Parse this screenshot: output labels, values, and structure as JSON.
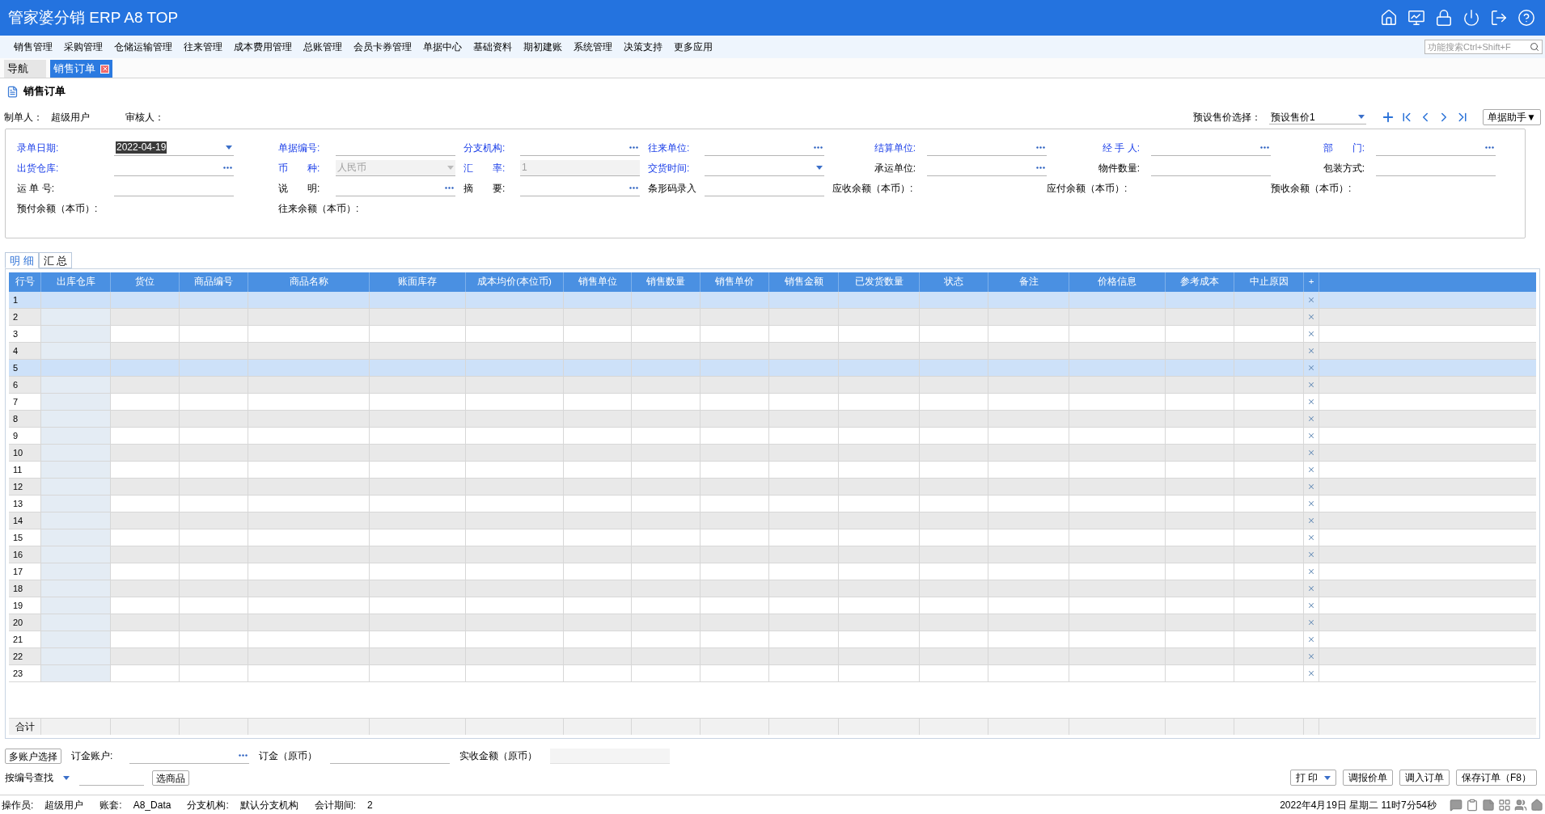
{
  "app_title": "管家婆分销 ERP A8 TOP",
  "menu": [
    "销售管理",
    "采购管理",
    "仓储运输管理",
    "往来管理",
    "成本费用管理",
    "总账管理",
    "会员卡券管理",
    "单据中心",
    "基础资料",
    "期初建账",
    "系统管理",
    "决策支持",
    "更多应用"
  ],
  "search": {
    "placeholder": "功能搜索Ctrl+Shift+F"
  },
  "tabs": [
    {
      "label": "导航",
      "selected": false,
      "closable": false
    },
    {
      "label": "销售订单",
      "selected": true,
      "closable": true
    }
  ],
  "page_title": "销售订单",
  "maker": {
    "label": "制单人：",
    "value": "超级用户",
    "reviewer_label": "审核人："
  },
  "price_select": {
    "label": "预设售价选择：",
    "value": "预设售价1"
  },
  "assistant_button": "单据助手▼",
  "form": [
    [
      {
        "label": "录单日期:",
        "required": true,
        "kind": "date",
        "value": "2022-04-19",
        "ellipsis": false,
        "dropdown": true,
        "disabled": false
      },
      {
        "label": "单据编号:",
        "required": true,
        "kind": "input",
        "ellipsis": false,
        "dropdown": false,
        "disabled": false
      },
      {
        "label": "分支机构:",
        "required": true,
        "kind": "input",
        "ellipsis": true,
        "dropdown": false,
        "disabled": false
      },
      {
        "label": "往来单位:",
        "required": true,
        "kind": "input",
        "ellipsis": true,
        "dropdown": false,
        "disabled": false
      },
      {
        "label": "结算单位:",
        "required": true,
        "kind": "input",
        "ellipsis": true,
        "dropdown": false,
        "disabled": false
      },
      {
        "label": "经 手 人:",
        "required": true,
        "kind": "input",
        "ellipsis": true,
        "dropdown": false,
        "disabled": false
      },
      {
        "label": "部　　门:",
        "required": true,
        "kind": "input",
        "ellipsis": true,
        "dropdown": false,
        "disabled": false
      }
    ],
    [
      {
        "label": "出货仓库:",
        "required": true,
        "kind": "input",
        "ellipsis": true,
        "dropdown": false,
        "disabled": false
      },
      {
        "label": "币　　种:",
        "required": true,
        "kind": "input",
        "value": "人民币",
        "ellipsis": false,
        "dropdown": true,
        "disabled": true
      },
      {
        "label": "汇　　率:",
        "required": true,
        "kind": "input",
        "value": "1",
        "ellipsis": false,
        "dropdown": false,
        "disabled": true
      },
      {
        "label": "交货时间:",
        "required": true,
        "kind": "input",
        "ellipsis": false,
        "dropdown": true,
        "disabled": false
      },
      {
        "label": "承运单位:",
        "required": false,
        "kind": "input",
        "ellipsis": true,
        "dropdown": false,
        "disabled": false
      },
      {
        "label": "物件数量:",
        "required": false,
        "kind": "input",
        "ellipsis": false,
        "dropdown": false,
        "disabled": false
      },
      {
        "label": "包装方式:",
        "required": false,
        "kind": "input",
        "ellipsis": false,
        "dropdown": false,
        "disabled": false
      }
    ],
    [
      {
        "label": "运 单 号:",
        "required": false,
        "kind": "input",
        "ellipsis": false,
        "dropdown": false,
        "disabled": false
      },
      {
        "label": "说　　明:",
        "required": false,
        "kind": "input",
        "ellipsis": true,
        "dropdown": false,
        "disabled": false
      },
      {
        "label": "摘　　要:",
        "required": false,
        "kind": "input",
        "ellipsis": true,
        "dropdown": false,
        "disabled": false
      },
      {
        "label": "条形码录入",
        "required": false,
        "kind": "input",
        "ellipsis": false,
        "dropdown": false,
        "disabled": false
      },
      {
        "label": "应收余额（本币）:",
        "required": false,
        "kind": "balance"
      },
      {
        "label": "应付余额（本币）:",
        "required": false,
        "kind": "balance"
      },
      {
        "label": "预收余额（本币）:",
        "required": false,
        "kind": "balance"
      }
    ],
    [
      {
        "label": "预付余额（本币）:",
        "required": false,
        "kind": "balance"
      },
      {
        "label": "往来余额（本币）:",
        "required": false,
        "kind": "balance"
      }
    ]
  ],
  "detail_tabs": [
    {
      "label": "明 细",
      "selected": true
    },
    {
      "label": "汇 总",
      "selected": false
    }
  ],
  "table": {
    "columns": [
      "行号",
      "出库仓库",
      "货位",
      "商品编号",
      "商品名称",
      "账面库存",
      "成本均价(本位币)",
      "销售单位",
      "销售数量",
      "销售单价",
      "销售金额",
      "已发货数量",
      "状态",
      "备注",
      "价格信息",
      "参考成本",
      "中止原因",
      "+"
    ],
    "rows": [
      {
        "number": "1",
        "selected": true
      },
      {
        "number": "2",
        "selected": false
      },
      {
        "number": "3",
        "selected": false
      },
      {
        "number": "4",
        "selected": false
      },
      {
        "number": "5",
        "selected": true
      },
      {
        "number": "6",
        "selected": false
      },
      {
        "number": "7",
        "selected": false
      },
      {
        "number": "8",
        "selected": false
      },
      {
        "number": "9",
        "selected": false
      },
      {
        "number": "10",
        "selected": false
      },
      {
        "number": "11",
        "selected": false
      },
      {
        "number": "12",
        "selected": false
      },
      {
        "number": "13",
        "selected": false
      },
      {
        "number": "14",
        "selected": false
      },
      {
        "number": "15",
        "selected": false
      },
      {
        "number": "16",
        "selected": false
      },
      {
        "number": "17",
        "selected": false
      },
      {
        "number": "18",
        "selected": false
      },
      {
        "number": "19",
        "selected": false
      },
      {
        "number": "20",
        "selected": false
      },
      {
        "number": "21",
        "selected": false
      },
      {
        "number": "22",
        "selected": false
      },
      {
        "number": "23",
        "selected": false
      }
    ],
    "total_label": "合计"
  },
  "bottom": {
    "multi_account_button": "多账户选择",
    "deposit_account_label": "订金账户:",
    "deposit_label": "订金（原币）",
    "received_label": "实收金额（原币）",
    "lookup_select": "按编号查找",
    "choose_button": "选商品",
    "actions": [
      {
        "label": "打 印",
        "dropdown": true
      },
      {
        "label": "调报价单",
        "dropdown": false
      },
      {
        "label": "调入订单",
        "dropdown": false
      },
      {
        "label": "保存订单（F8）",
        "dropdown": false
      }
    ]
  },
  "status_bar": [
    {
      "label": "操作员:",
      "value": "超级用户"
    },
    {
      "label": "账套:",
      "value": "A8_Data"
    },
    {
      "label": "分支机构:",
      "value": "默认分支机构"
    },
    {
      "label": "会计期间:",
      "value": "2"
    }
  ],
  "clock": "2022年4月19日 星期二 11时7分54秒"
}
